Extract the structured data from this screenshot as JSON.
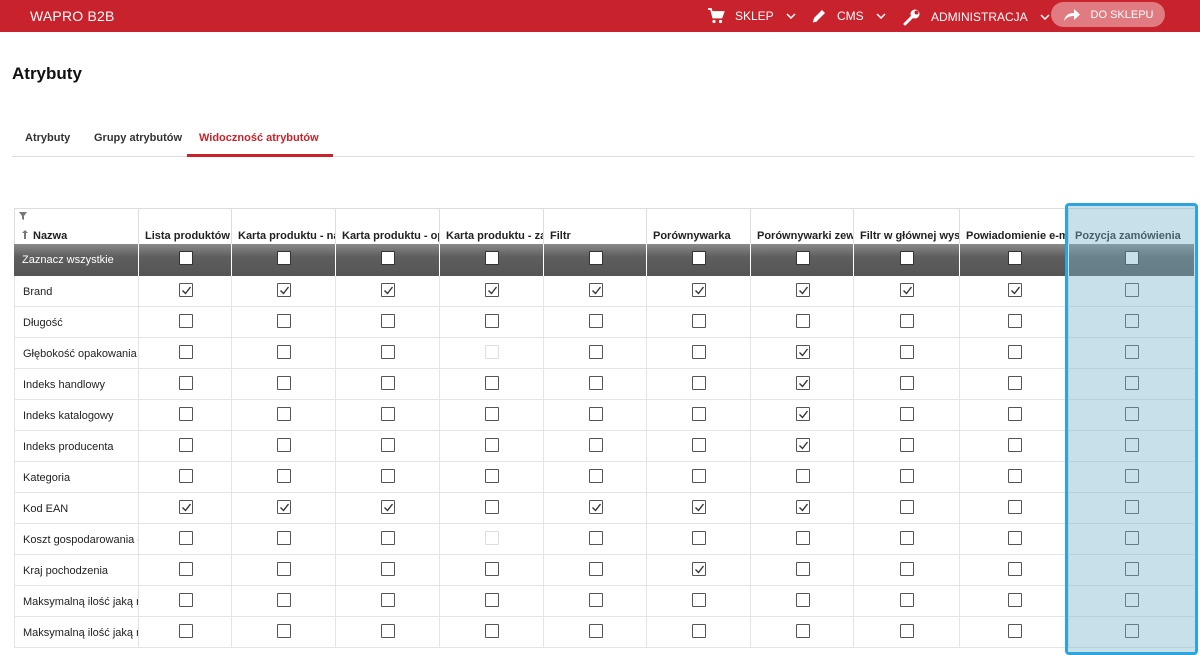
{
  "topbar": {
    "brand": "WAPRO B2B",
    "nav": [
      {
        "label": "SKLEP",
        "icon": "cart-icon"
      },
      {
        "label": "CMS",
        "icon": "pencil-icon"
      },
      {
        "label": "ADMINISTRACJA",
        "icon": "wrench-icon"
      }
    ],
    "shop_button": "DO SKLEPU"
  },
  "page": {
    "title": "Atrybuty"
  },
  "tabs": [
    {
      "label": "Atrybuty",
      "active": false
    },
    {
      "label": "Grupy atrybutów",
      "active": false
    },
    {
      "label": "Widoczność atrybutów",
      "active": true
    }
  ],
  "table": {
    "name_header": "Nazwa",
    "select_all_label": "Zaznacz wszystkie",
    "columns": [
      "Lista produktów",
      "Karta produktu - nag",
      "Karta produktu - opi:",
      "Karta produktu - zak",
      "Filtr",
      "Porównywarka",
      "Porównywarki zewnę",
      "Filtr w głównej wysz:",
      "Powiadomienie e-mai",
      "Pozycja zamówienia"
    ],
    "rows": [
      {
        "name": "Brand",
        "checks": [
          1,
          1,
          1,
          1,
          1,
          1,
          1,
          1,
          1,
          0
        ]
      },
      {
        "name": "Długość",
        "checks": [
          0,
          0,
          0,
          0,
          0,
          0,
          0,
          0,
          0,
          0
        ]
      },
      {
        "name": "Głębokość opakowania [",
        "checks": [
          0,
          0,
          0,
          2,
          0,
          0,
          1,
          0,
          0,
          0
        ]
      },
      {
        "name": "Indeks handlowy",
        "checks": [
          0,
          0,
          0,
          0,
          0,
          0,
          1,
          0,
          0,
          0
        ]
      },
      {
        "name": "Indeks katalogowy",
        "checks": [
          0,
          0,
          0,
          0,
          0,
          0,
          1,
          0,
          0,
          0
        ]
      },
      {
        "name": "Indeks producenta",
        "checks": [
          0,
          0,
          0,
          0,
          0,
          0,
          1,
          0,
          0,
          0
        ]
      },
      {
        "name": "Kategoria",
        "checks": [
          0,
          0,
          0,
          0,
          0,
          0,
          0,
          0,
          0,
          0
        ]
      },
      {
        "name": "Kod EAN",
        "checks": [
          1,
          1,
          1,
          0,
          1,
          1,
          1,
          0,
          0,
          0
        ]
      },
      {
        "name": "Koszt gospodarowania o",
        "checks": [
          0,
          0,
          0,
          2,
          0,
          0,
          0,
          0,
          0,
          0
        ]
      },
      {
        "name": "Kraj pochodzenia",
        "checks": [
          0,
          0,
          0,
          0,
          0,
          1,
          0,
          0,
          0,
          0
        ]
      },
      {
        "name": "Maksymalną ilość jaką n",
        "checks": [
          0,
          0,
          0,
          0,
          0,
          0,
          0,
          0,
          0,
          0
        ]
      },
      {
        "name": "Maksymalną ilość jaką n",
        "checks": [
          0,
          0,
          0,
          0,
          0,
          0,
          0,
          0,
          0,
          0
        ]
      }
    ]
  },
  "colors": {
    "brand_red": "#c8232c",
    "highlight_border": "#2ea3dc",
    "select_row_bg": "#5e5e5e"
  }
}
